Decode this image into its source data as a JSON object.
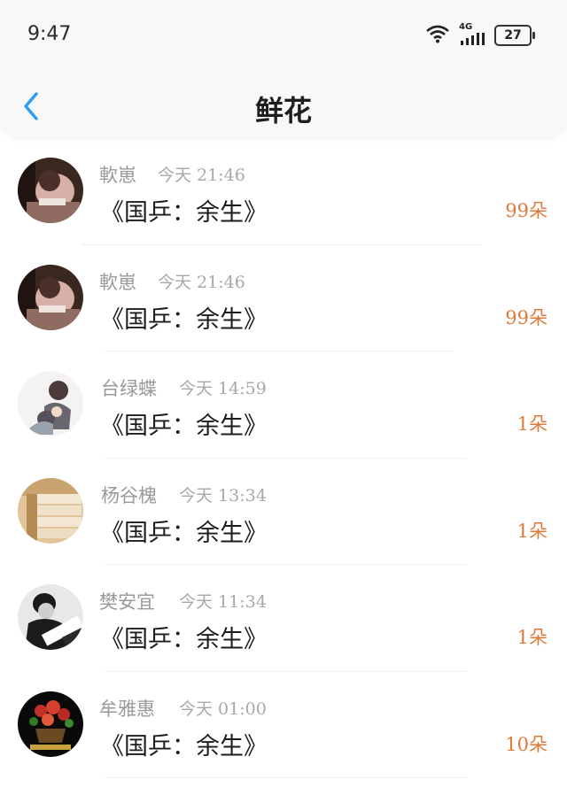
{
  "status_bar": {
    "time": "9:47",
    "network": "4G",
    "battery": "27"
  },
  "header": {
    "title": "鲜花"
  },
  "rows": [
    {
      "name": "軟崽",
      "time": "今天 21:46",
      "work": "《国乒：余生》",
      "count": "99朵"
    },
    {
      "name": "軟崽",
      "time": "今天 21:46",
      "work": "《国乒：余生》",
      "count": "99朵"
    },
    {
      "name": "台绿蝶",
      "time": "今天 14:59",
      "work": "《国乒：余生》",
      "count": "1朵"
    },
    {
      "name": "杨谷槐",
      "time": "今天 13:34",
      "work": "《国乒：余生》",
      "count": "1朵"
    },
    {
      "name": "樊安宜",
      "time": "今天 11:34",
      "work": "《国乒：余生》",
      "count": "1朵"
    },
    {
      "name": "牟雅惠",
      "time": "今天 01:00",
      "work": "《国乒：余生》",
      "count": "10朵"
    }
  ],
  "colors": {
    "accent": "#2d9cf0",
    "count": "#e07a3a",
    "muted": "#9a9a9a"
  },
  "icons": [
    "back-arrow-icon",
    "wifi-icon",
    "signal-icon",
    "battery-icon"
  ]
}
